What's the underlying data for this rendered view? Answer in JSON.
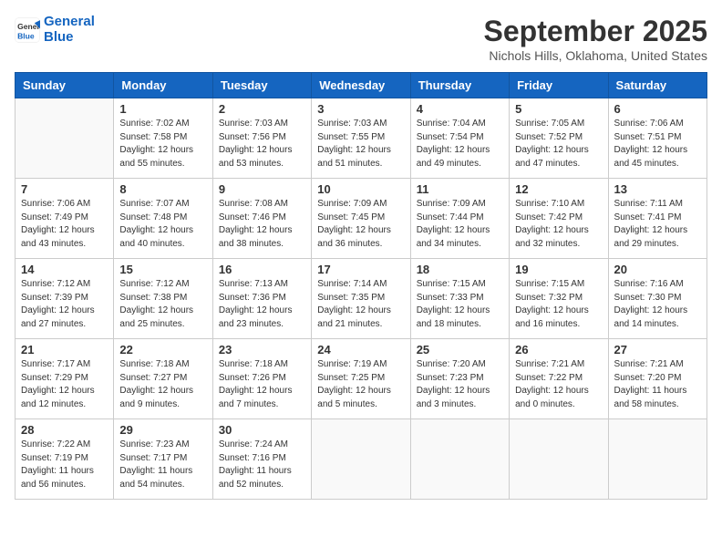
{
  "header": {
    "logo_line1": "General",
    "logo_line2": "Blue",
    "month": "September 2025",
    "location": "Nichols Hills, Oklahoma, United States"
  },
  "days_of_week": [
    "Sunday",
    "Monday",
    "Tuesday",
    "Wednesday",
    "Thursday",
    "Friday",
    "Saturday"
  ],
  "weeks": [
    [
      {
        "day": "",
        "sunrise": "",
        "sunset": "",
        "daylight": ""
      },
      {
        "day": "1",
        "sunrise": "Sunrise: 7:02 AM",
        "sunset": "Sunset: 7:58 PM",
        "daylight": "Daylight: 12 hours and 55 minutes."
      },
      {
        "day": "2",
        "sunrise": "Sunrise: 7:03 AM",
        "sunset": "Sunset: 7:56 PM",
        "daylight": "Daylight: 12 hours and 53 minutes."
      },
      {
        "day": "3",
        "sunrise": "Sunrise: 7:03 AM",
        "sunset": "Sunset: 7:55 PM",
        "daylight": "Daylight: 12 hours and 51 minutes."
      },
      {
        "day": "4",
        "sunrise": "Sunrise: 7:04 AM",
        "sunset": "Sunset: 7:54 PM",
        "daylight": "Daylight: 12 hours and 49 minutes."
      },
      {
        "day": "5",
        "sunrise": "Sunrise: 7:05 AM",
        "sunset": "Sunset: 7:52 PM",
        "daylight": "Daylight: 12 hours and 47 minutes."
      },
      {
        "day": "6",
        "sunrise": "Sunrise: 7:06 AM",
        "sunset": "Sunset: 7:51 PM",
        "daylight": "Daylight: 12 hours and 45 minutes."
      }
    ],
    [
      {
        "day": "7",
        "sunrise": "Sunrise: 7:06 AM",
        "sunset": "Sunset: 7:49 PM",
        "daylight": "Daylight: 12 hours and 43 minutes."
      },
      {
        "day": "8",
        "sunrise": "Sunrise: 7:07 AM",
        "sunset": "Sunset: 7:48 PM",
        "daylight": "Daylight: 12 hours and 40 minutes."
      },
      {
        "day": "9",
        "sunrise": "Sunrise: 7:08 AM",
        "sunset": "Sunset: 7:46 PM",
        "daylight": "Daylight: 12 hours and 38 minutes."
      },
      {
        "day": "10",
        "sunrise": "Sunrise: 7:09 AM",
        "sunset": "Sunset: 7:45 PM",
        "daylight": "Daylight: 12 hours and 36 minutes."
      },
      {
        "day": "11",
        "sunrise": "Sunrise: 7:09 AM",
        "sunset": "Sunset: 7:44 PM",
        "daylight": "Daylight: 12 hours and 34 minutes."
      },
      {
        "day": "12",
        "sunrise": "Sunrise: 7:10 AM",
        "sunset": "Sunset: 7:42 PM",
        "daylight": "Daylight: 12 hours and 32 minutes."
      },
      {
        "day": "13",
        "sunrise": "Sunrise: 7:11 AM",
        "sunset": "Sunset: 7:41 PM",
        "daylight": "Daylight: 12 hours and 29 minutes."
      }
    ],
    [
      {
        "day": "14",
        "sunrise": "Sunrise: 7:12 AM",
        "sunset": "Sunset: 7:39 PM",
        "daylight": "Daylight: 12 hours and 27 minutes."
      },
      {
        "day": "15",
        "sunrise": "Sunrise: 7:12 AM",
        "sunset": "Sunset: 7:38 PM",
        "daylight": "Daylight: 12 hours and 25 minutes."
      },
      {
        "day": "16",
        "sunrise": "Sunrise: 7:13 AM",
        "sunset": "Sunset: 7:36 PM",
        "daylight": "Daylight: 12 hours and 23 minutes."
      },
      {
        "day": "17",
        "sunrise": "Sunrise: 7:14 AM",
        "sunset": "Sunset: 7:35 PM",
        "daylight": "Daylight: 12 hours and 21 minutes."
      },
      {
        "day": "18",
        "sunrise": "Sunrise: 7:15 AM",
        "sunset": "Sunset: 7:33 PM",
        "daylight": "Daylight: 12 hours and 18 minutes."
      },
      {
        "day": "19",
        "sunrise": "Sunrise: 7:15 AM",
        "sunset": "Sunset: 7:32 PM",
        "daylight": "Daylight: 12 hours and 16 minutes."
      },
      {
        "day": "20",
        "sunrise": "Sunrise: 7:16 AM",
        "sunset": "Sunset: 7:30 PM",
        "daylight": "Daylight: 12 hours and 14 minutes."
      }
    ],
    [
      {
        "day": "21",
        "sunrise": "Sunrise: 7:17 AM",
        "sunset": "Sunset: 7:29 PM",
        "daylight": "Daylight: 12 hours and 12 minutes."
      },
      {
        "day": "22",
        "sunrise": "Sunrise: 7:18 AM",
        "sunset": "Sunset: 7:27 PM",
        "daylight": "Daylight: 12 hours and 9 minutes."
      },
      {
        "day": "23",
        "sunrise": "Sunrise: 7:18 AM",
        "sunset": "Sunset: 7:26 PM",
        "daylight": "Daylight: 12 hours and 7 minutes."
      },
      {
        "day": "24",
        "sunrise": "Sunrise: 7:19 AM",
        "sunset": "Sunset: 7:25 PM",
        "daylight": "Daylight: 12 hours and 5 minutes."
      },
      {
        "day": "25",
        "sunrise": "Sunrise: 7:20 AM",
        "sunset": "Sunset: 7:23 PM",
        "daylight": "Daylight: 12 hours and 3 minutes."
      },
      {
        "day": "26",
        "sunrise": "Sunrise: 7:21 AM",
        "sunset": "Sunset: 7:22 PM",
        "daylight": "Daylight: 12 hours and 0 minutes."
      },
      {
        "day": "27",
        "sunrise": "Sunrise: 7:21 AM",
        "sunset": "Sunset: 7:20 PM",
        "daylight": "Daylight: 11 hours and 58 minutes."
      }
    ],
    [
      {
        "day": "28",
        "sunrise": "Sunrise: 7:22 AM",
        "sunset": "Sunset: 7:19 PM",
        "daylight": "Daylight: 11 hours and 56 minutes."
      },
      {
        "day": "29",
        "sunrise": "Sunrise: 7:23 AM",
        "sunset": "Sunset: 7:17 PM",
        "daylight": "Daylight: 11 hours and 54 minutes."
      },
      {
        "day": "30",
        "sunrise": "Sunrise: 7:24 AM",
        "sunset": "Sunset: 7:16 PM",
        "daylight": "Daylight: 11 hours and 52 minutes."
      },
      {
        "day": "",
        "sunrise": "",
        "sunset": "",
        "daylight": ""
      },
      {
        "day": "",
        "sunrise": "",
        "sunset": "",
        "daylight": ""
      },
      {
        "day": "",
        "sunrise": "",
        "sunset": "",
        "daylight": ""
      },
      {
        "day": "",
        "sunrise": "",
        "sunset": "",
        "daylight": ""
      }
    ]
  ]
}
